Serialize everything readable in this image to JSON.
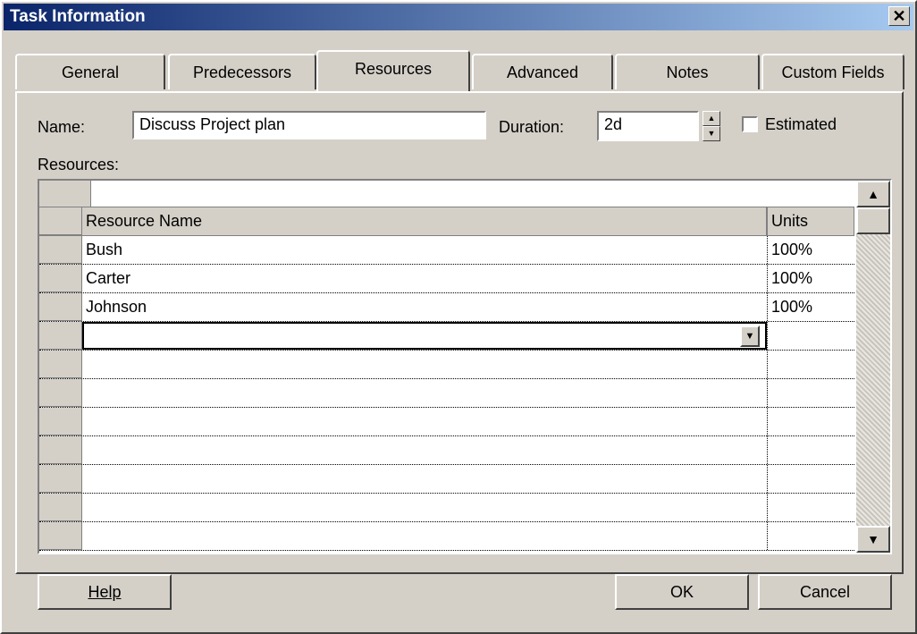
{
  "window": {
    "title": "Task Information",
    "close_glyph": "✕"
  },
  "tabs": [
    {
      "label": "General"
    },
    {
      "label": "Predecessors"
    },
    {
      "label": "Resources"
    },
    {
      "label": "Advanced"
    },
    {
      "label": "Notes"
    },
    {
      "label": "Custom Fields"
    }
  ],
  "active_tab": "Resources",
  "form": {
    "name_label": "Name:",
    "name_value": "Discuss Project plan",
    "duration_label": "Duration:",
    "duration_value": "2d",
    "estimated_label": "Estimated",
    "estimated_checked": false,
    "resources_label": "Resources:"
  },
  "grid": {
    "columns": [
      "Resource Name",
      "Units"
    ],
    "rows": [
      {
        "name": "Bush",
        "units": "100%"
      },
      {
        "name": "Carter",
        "units": "100%"
      },
      {
        "name": "Johnson",
        "units": "100%"
      },
      {
        "name": "",
        "units": ""
      },
      {
        "name": "",
        "units": ""
      },
      {
        "name": "",
        "units": ""
      },
      {
        "name": "",
        "units": ""
      },
      {
        "name": "",
        "units": ""
      },
      {
        "name": "",
        "units": ""
      },
      {
        "name": "",
        "units": ""
      },
      {
        "name": "",
        "units": ""
      }
    ]
  },
  "buttons": {
    "help": "Help",
    "ok": "OK",
    "cancel": "Cancel"
  }
}
